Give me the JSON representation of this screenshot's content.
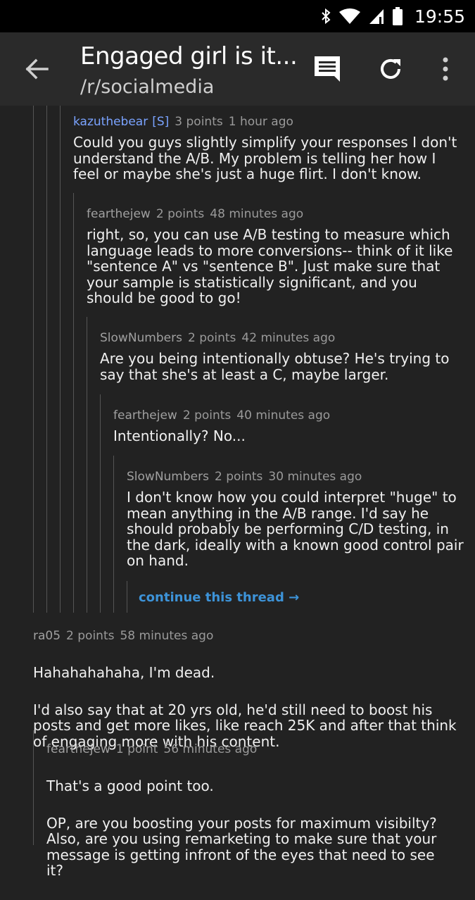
{
  "status_bar": {
    "time": "19:55",
    "icons": [
      "bluetooth-icon",
      "wifi-icon",
      "signal-icon",
      "battery-icon"
    ]
  },
  "app_bar": {
    "title": "Engaged girl is it...",
    "subtitle": "/r/socialmedia",
    "actions": [
      "comments-icon",
      "refresh-icon",
      "more-vert-icon"
    ]
  },
  "colors": {
    "background": "#222222",
    "app_bar": "#2a2a2a",
    "op_author": "#7aa3ff",
    "link": "#3d93d8"
  },
  "comments": [
    {
      "author": "kazuthebear",
      "tag": "[S]",
      "points": "3 points",
      "age": "1 hour ago",
      "body": "Could you guys slightly simplify your responses I don't understand the A/B. My problem is telling her how I feel or maybe she's just a huge flirt. I don't know."
    },
    {
      "author": "fearthejew",
      "points": "2 points",
      "age": "48 minutes ago",
      "body": "right, so, you can use A/B testing to measure which language leads to more conversions-- think of it like \"sentence A\" vs \"sentence B\". Just make sure that your sample is statistically significant, and you should be good to go!"
    },
    {
      "author": "SlowNumbers",
      "points": "2 points",
      "age": "42 minutes ago",
      "body": "Are you being intentionally obtuse? He's trying to say that she's at least a C, maybe larger."
    },
    {
      "author": "fearthejew",
      "points": "2 points",
      "age": "40 minutes ago",
      "body": "Intentionally? No..."
    },
    {
      "author": "SlowNumbers",
      "points": "2 points",
      "age": "30 minutes ago",
      "body": "I don't know how you could interpret \"huge\" to mean anything in the A/B range. I'd say he should probably be performing C/D testing, in the dark, ideally with a known good control pair on hand."
    },
    {
      "author": "ra05",
      "points": "2 points",
      "age": "58 minutes ago",
      "body_p1": "Hahahahahaha, I'm dead.",
      "body_p2": "I'd also say that at 20 yrs old, he'd still need to boost his posts and get more likes, like reach 25K and after that think of engaging more with his content."
    },
    {
      "author": "fearthejew",
      "points": "1 point",
      "age": "56 minutes ago",
      "body_p1": "That's a good point too.",
      "body_p2": "OP, are you boosting your posts for maximum visibilty? Also, are you using remarketing to make sure that your message is getting infront of the eyes that need to see it?"
    }
  ],
  "continue_thread": "continue this thread →"
}
